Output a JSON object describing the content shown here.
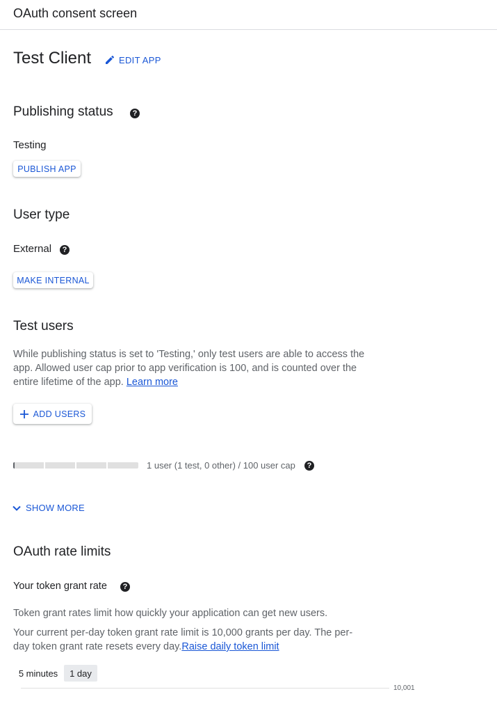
{
  "header": {
    "title": "OAuth consent screen"
  },
  "app": {
    "name": "Test Client",
    "edit_label": "EDIT APP"
  },
  "publishing": {
    "heading": "Publishing status",
    "status": "Testing",
    "publish_label": "PUBLISH APP"
  },
  "user_type": {
    "heading": "User type",
    "value": "External",
    "make_internal_label": "MAKE INTERNAL"
  },
  "test_users": {
    "heading": "Test users",
    "description": "While publishing status is set to 'Testing,' only test users are able to access the app. Allowed user cap prior to app verification is 100, and is counted over the entire lifetime of the app.",
    "learn_more": "Learn more",
    "add_users_label": "ADD USERS",
    "cap_text": "1 user (1 test, 0 other) / 100 user cap",
    "cap_used": 1,
    "cap_total": 100,
    "show_more_label": "SHOW MORE"
  },
  "rate_limits": {
    "heading": "OAuth rate limits",
    "subheading": "Your token grant rate",
    "description1": "Token grant rates limit how quickly your application can get new users.",
    "description2": "Your current per-day token grant rate limit is 10,000 grants per day. The per-day token grant rate resets every day.",
    "raise_link": "Raise daily token limit",
    "range_options": [
      "5 minutes",
      "1 day"
    ],
    "selected_range": "1 day",
    "axis_max_label": "10,001"
  },
  "colors": {
    "accent": "#1a57d6",
    "text": "#202124",
    "muted": "#5f6368",
    "divider": "#dadce0"
  }
}
